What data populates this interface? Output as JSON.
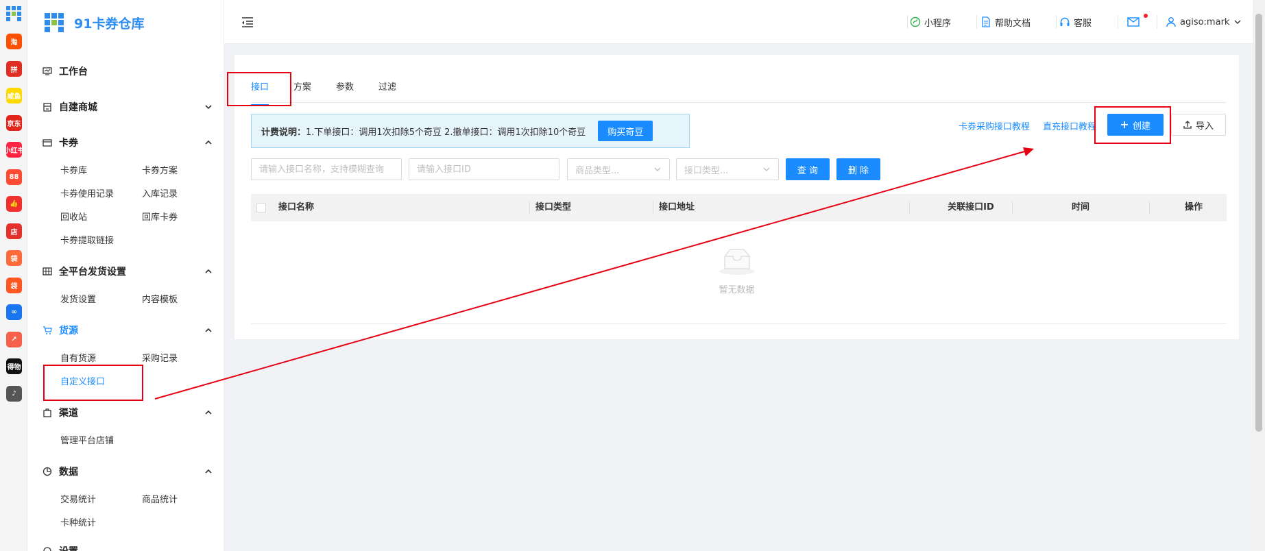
{
  "app": {
    "brand_name": "91卡券仓库",
    "brand_color": "#2d8cf0",
    "rail_apps": [
      {
        "icon": "taobao-icon",
        "glyph": "淘",
        "color": "#ff5000"
      },
      {
        "icon": "pinduoduo-icon",
        "glyph": "拼",
        "color": "#e02e24"
      },
      {
        "icon": "xianyu-icon",
        "glyph": "咸鱼",
        "color": "#ffda00"
      },
      {
        "icon": "jd-icon",
        "glyph": "京东",
        "color": "#e1251b"
      },
      {
        "icon": "xiaohongshu-icon",
        "glyph": "小红书",
        "color": "#ff2442"
      },
      {
        "icon": "meituan-icon",
        "glyph": "88",
        "color": "#ff4b33"
      },
      {
        "icon": "like-icon",
        "glyph": "👍",
        "color": "#f0302c"
      },
      {
        "icon": "dian-icon",
        "glyph": "店",
        "color": "#e3322d"
      },
      {
        "icon": "shop-bag-icon",
        "glyph": "袋",
        "color": "#ff6a3a"
      },
      {
        "icon": "shopping-icon",
        "glyph": "袋",
        "color": "#ff5722"
      },
      {
        "icon": "link-icon",
        "glyph": "∞",
        "color": "#1976f0"
      },
      {
        "icon": "doc-share-icon",
        "glyph": "↗",
        "color": "#f6614b"
      },
      {
        "icon": "dewu-icon",
        "glyph": "得物",
        "color": "#111111"
      },
      {
        "icon": "douyin-icon",
        "glyph": "♪",
        "color": "#555555"
      }
    ]
  },
  "sidebar": {
    "groups": [
      {
        "key": "workbench",
        "label": "工作台",
        "icon": "dashboard-icon",
        "chevron": ""
      },
      {
        "key": "mall",
        "label": "自建商城",
        "icon": "store-icon",
        "chevron": "down"
      },
      {
        "key": "coupon",
        "label": "卡券",
        "icon": "card-icon",
        "chevron": "up"
      },
      {
        "key": "delivery",
        "label": "全平台发货设置",
        "icon": "grid-icon",
        "chevron": "up"
      },
      {
        "key": "source",
        "label": "货源",
        "icon": "cart-icon",
        "chevron": "up"
      },
      {
        "key": "channel",
        "label": "渠道",
        "icon": "bag-icon",
        "chevron": "up"
      },
      {
        "key": "data",
        "label": "数据",
        "icon": "pie-chart-icon",
        "chevron": "up"
      },
      {
        "key": "settings",
        "label": "设置",
        "icon": "settings-icon",
        "chevron": ""
      }
    ],
    "coupon_items": [
      "卡券库",
      "卡券方案",
      "卡券使用记录",
      "入库记录",
      "回收站",
      "回库卡券",
      "卡券提取链接"
    ],
    "delivery_items": [
      "发货设置",
      "内容模板"
    ],
    "source_items": [
      "自有货源",
      "采购记录",
      "自定义接口"
    ],
    "channel_items": [
      "管理平台店铺"
    ],
    "data_items": [
      "交易统计",
      "商品统计",
      "卡种统计"
    ]
  },
  "header": {
    "mini_program": "小程序",
    "help_docs": "帮助文档",
    "customer_service": "客服",
    "username": "agiso:mark"
  },
  "tabs": [
    "接口",
    "方案",
    "参数",
    "过滤"
  ],
  "notice": {
    "title": "计费说明：",
    "text": "1.下单接口：调用1次扣除5个奇豆  2.撤单接口：调用1次扣除10个奇豆",
    "buy_button": "购买奇豆"
  },
  "links": {
    "coupon_tutorial": "卡券采购接口教程",
    "recharge_tutorial": "直充接口教程"
  },
  "actions": {
    "create": "创建",
    "import": "导入",
    "query": "查 询",
    "delete": "删 除"
  },
  "filters": {
    "name_placeholder": "请输入接口名称，支持模糊查询",
    "id_placeholder": "请输入接口ID",
    "goods_type_placeholder": "商品类型...",
    "api_type_placeholder": "接口类型..."
  },
  "table": {
    "columns": [
      "接口名称",
      "接口类型",
      "接口地址",
      "关联接口ID",
      "时间",
      "操作"
    ],
    "rows": [],
    "empty_text": "暂无数据"
  },
  "colors": {
    "primary": "#1a8cff",
    "annotation": "#e60012"
  }
}
